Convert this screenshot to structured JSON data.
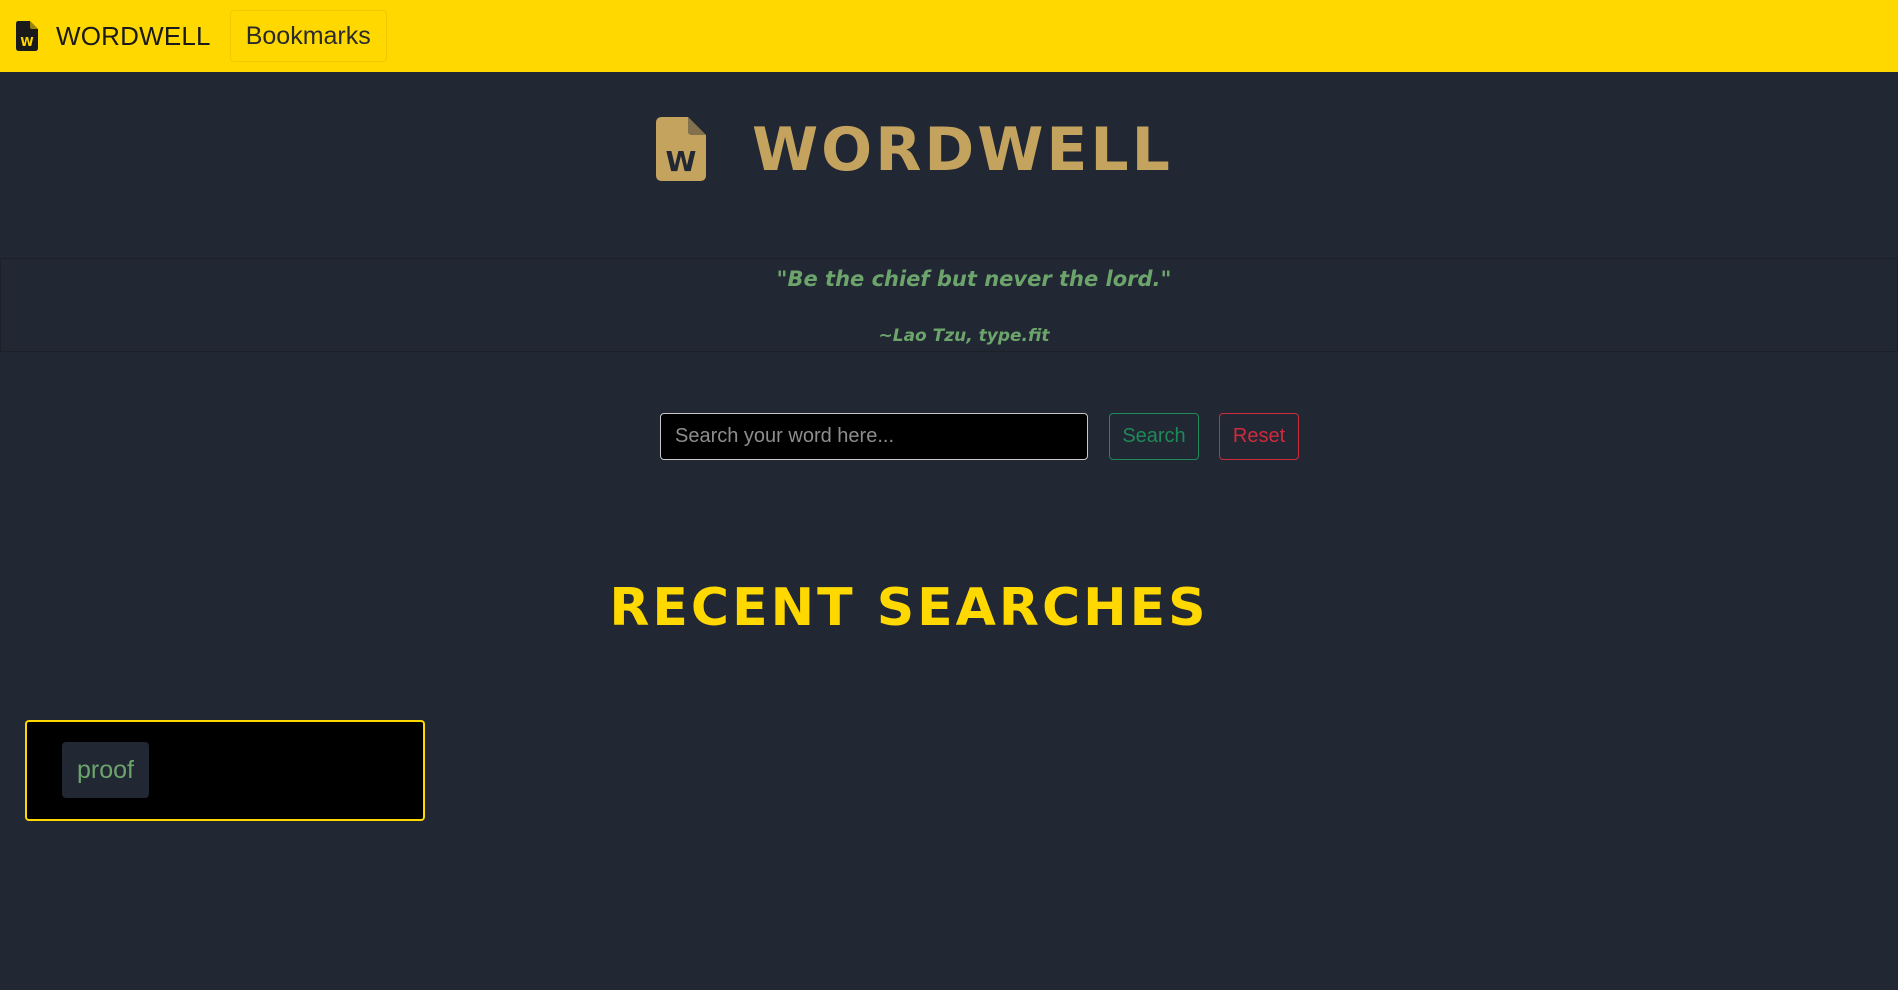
{
  "navbar": {
    "brand_icon": "file-word-icon",
    "brand": "WORDWELL",
    "bookmarks": "Bookmarks"
  },
  "hero": {
    "icon": "file-word-icon",
    "title": "WORDWELL"
  },
  "quote": {
    "text": "\"Be the chief but never the lord.\"",
    "author": "~Lao Tzu, type.fit"
  },
  "search": {
    "placeholder": "Search your word here...",
    "value": "",
    "search_label": "Search",
    "reset_label": "Reset"
  },
  "recent": {
    "title": "RECENT SEARCHES",
    "items": [
      "proof"
    ]
  },
  "colors": {
    "navbar": "#ffd800",
    "background": "#212733",
    "logo_gold": "#c4a35f",
    "quote_green": "#6ca46c",
    "search_green": "#1d8a57",
    "reset_red": "#cf2b3e",
    "accent_yellow": "#ffd800"
  }
}
